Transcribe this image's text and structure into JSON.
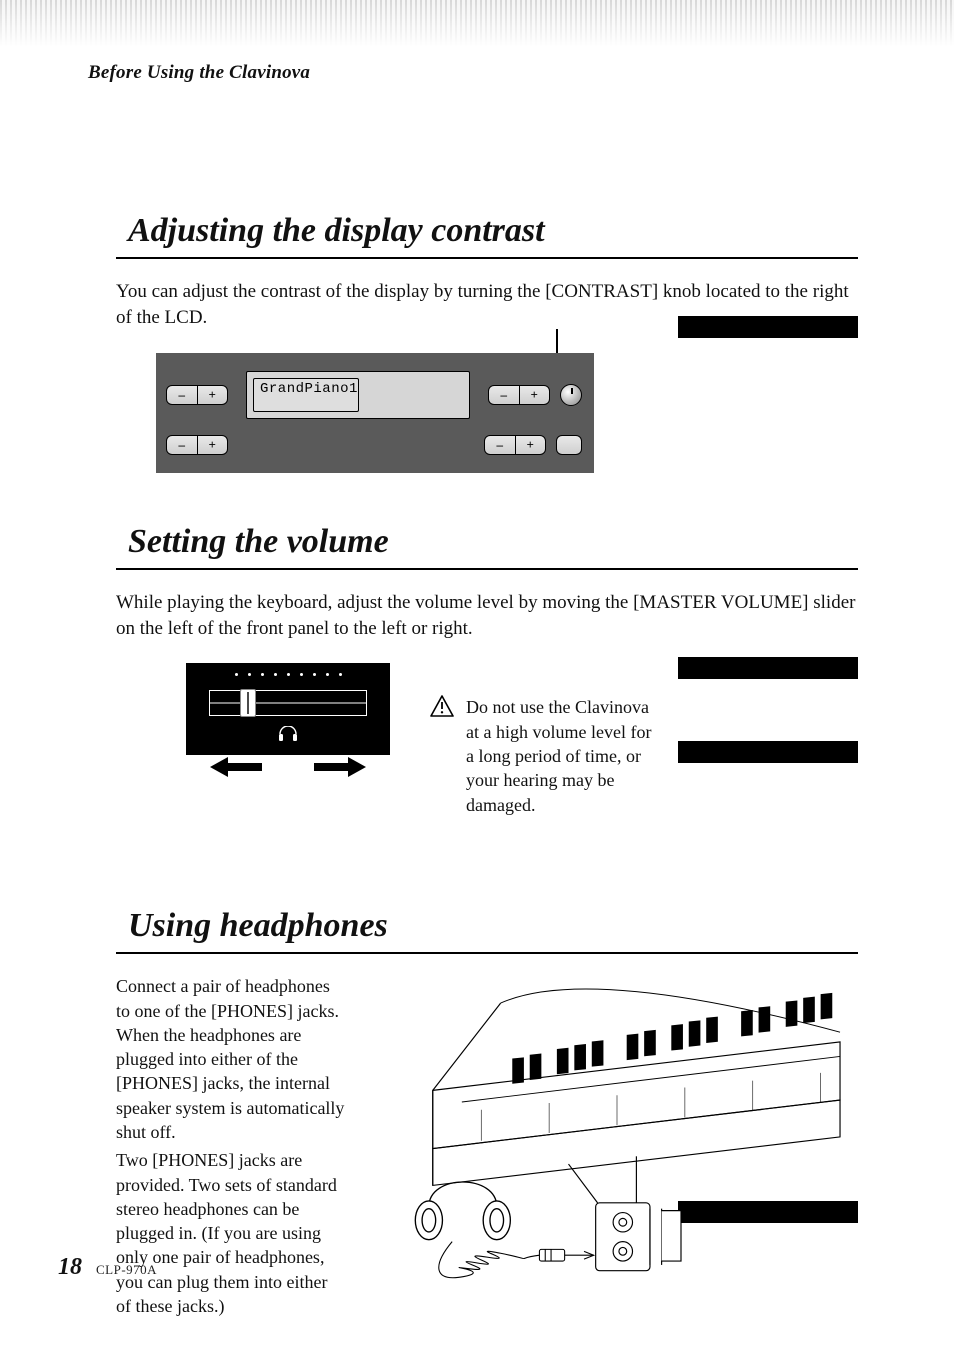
{
  "running_head": "Before Using the Clavinova",
  "footer": {
    "page": "18",
    "model": "CLP-970A"
  },
  "sections": {
    "contrast": {
      "heading": "Adjusting the display contrast",
      "body": "You can adjust the contrast of the display by turning the [CONTRAST] knob located to the right of the LCD.",
      "lcd_text": "GrandPiano1",
      "btn_minus": "–",
      "btn_plus": "+"
    },
    "volume": {
      "heading": "Setting the volume",
      "body": "While playing the keyboard, adjust the volume level by moving the [MASTER VOLUME] slider on the left of the front panel to the left or right.",
      "caution": "Do not use the Clavinova at a high volume level for a long period of time, or your hearing may be damaged."
    },
    "headphones": {
      "heading": "Using headphones",
      "para1": "Connect a pair of headphones to one of the [PHONES] jacks. When the headphones are plugged into either of the [PHONES] jacks, the internal speaker system is automatically shut off.",
      "para2": "Two [PHONES] jacks are provided. Two sets of standard stereo headphones can be plugged in. (If you are using only one pair of headphones, you can plug them into either of these jacks.)"
    }
  }
}
